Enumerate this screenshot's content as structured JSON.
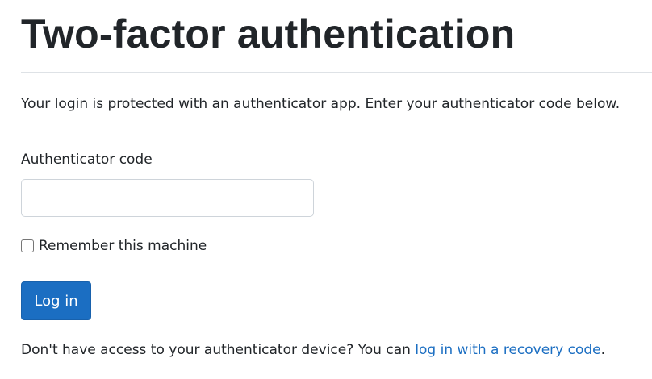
{
  "page": {
    "title": "Two-factor authentication",
    "intro": "Your login is protected with an authenticator app. Enter your authenticator code below."
  },
  "form": {
    "code_label": "Authenticator code",
    "code_value": "",
    "code_placeholder": "",
    "remember_label": "Remember this machine",
    "remember_checked": false,
    "submit_label": "Log in"
  },
  "recovery": {
    "prefix": "Don't have access to your authenticator device? You can ",
    "link_text": "log in with a recovery code",
    "suffix": "."
  },
  "colors": {
    "primary_button": "#1b6ec2",
    "link": "#1b6ec2",
    "text": "#212529",
    "divider": "#dee2e6"
  }
}
